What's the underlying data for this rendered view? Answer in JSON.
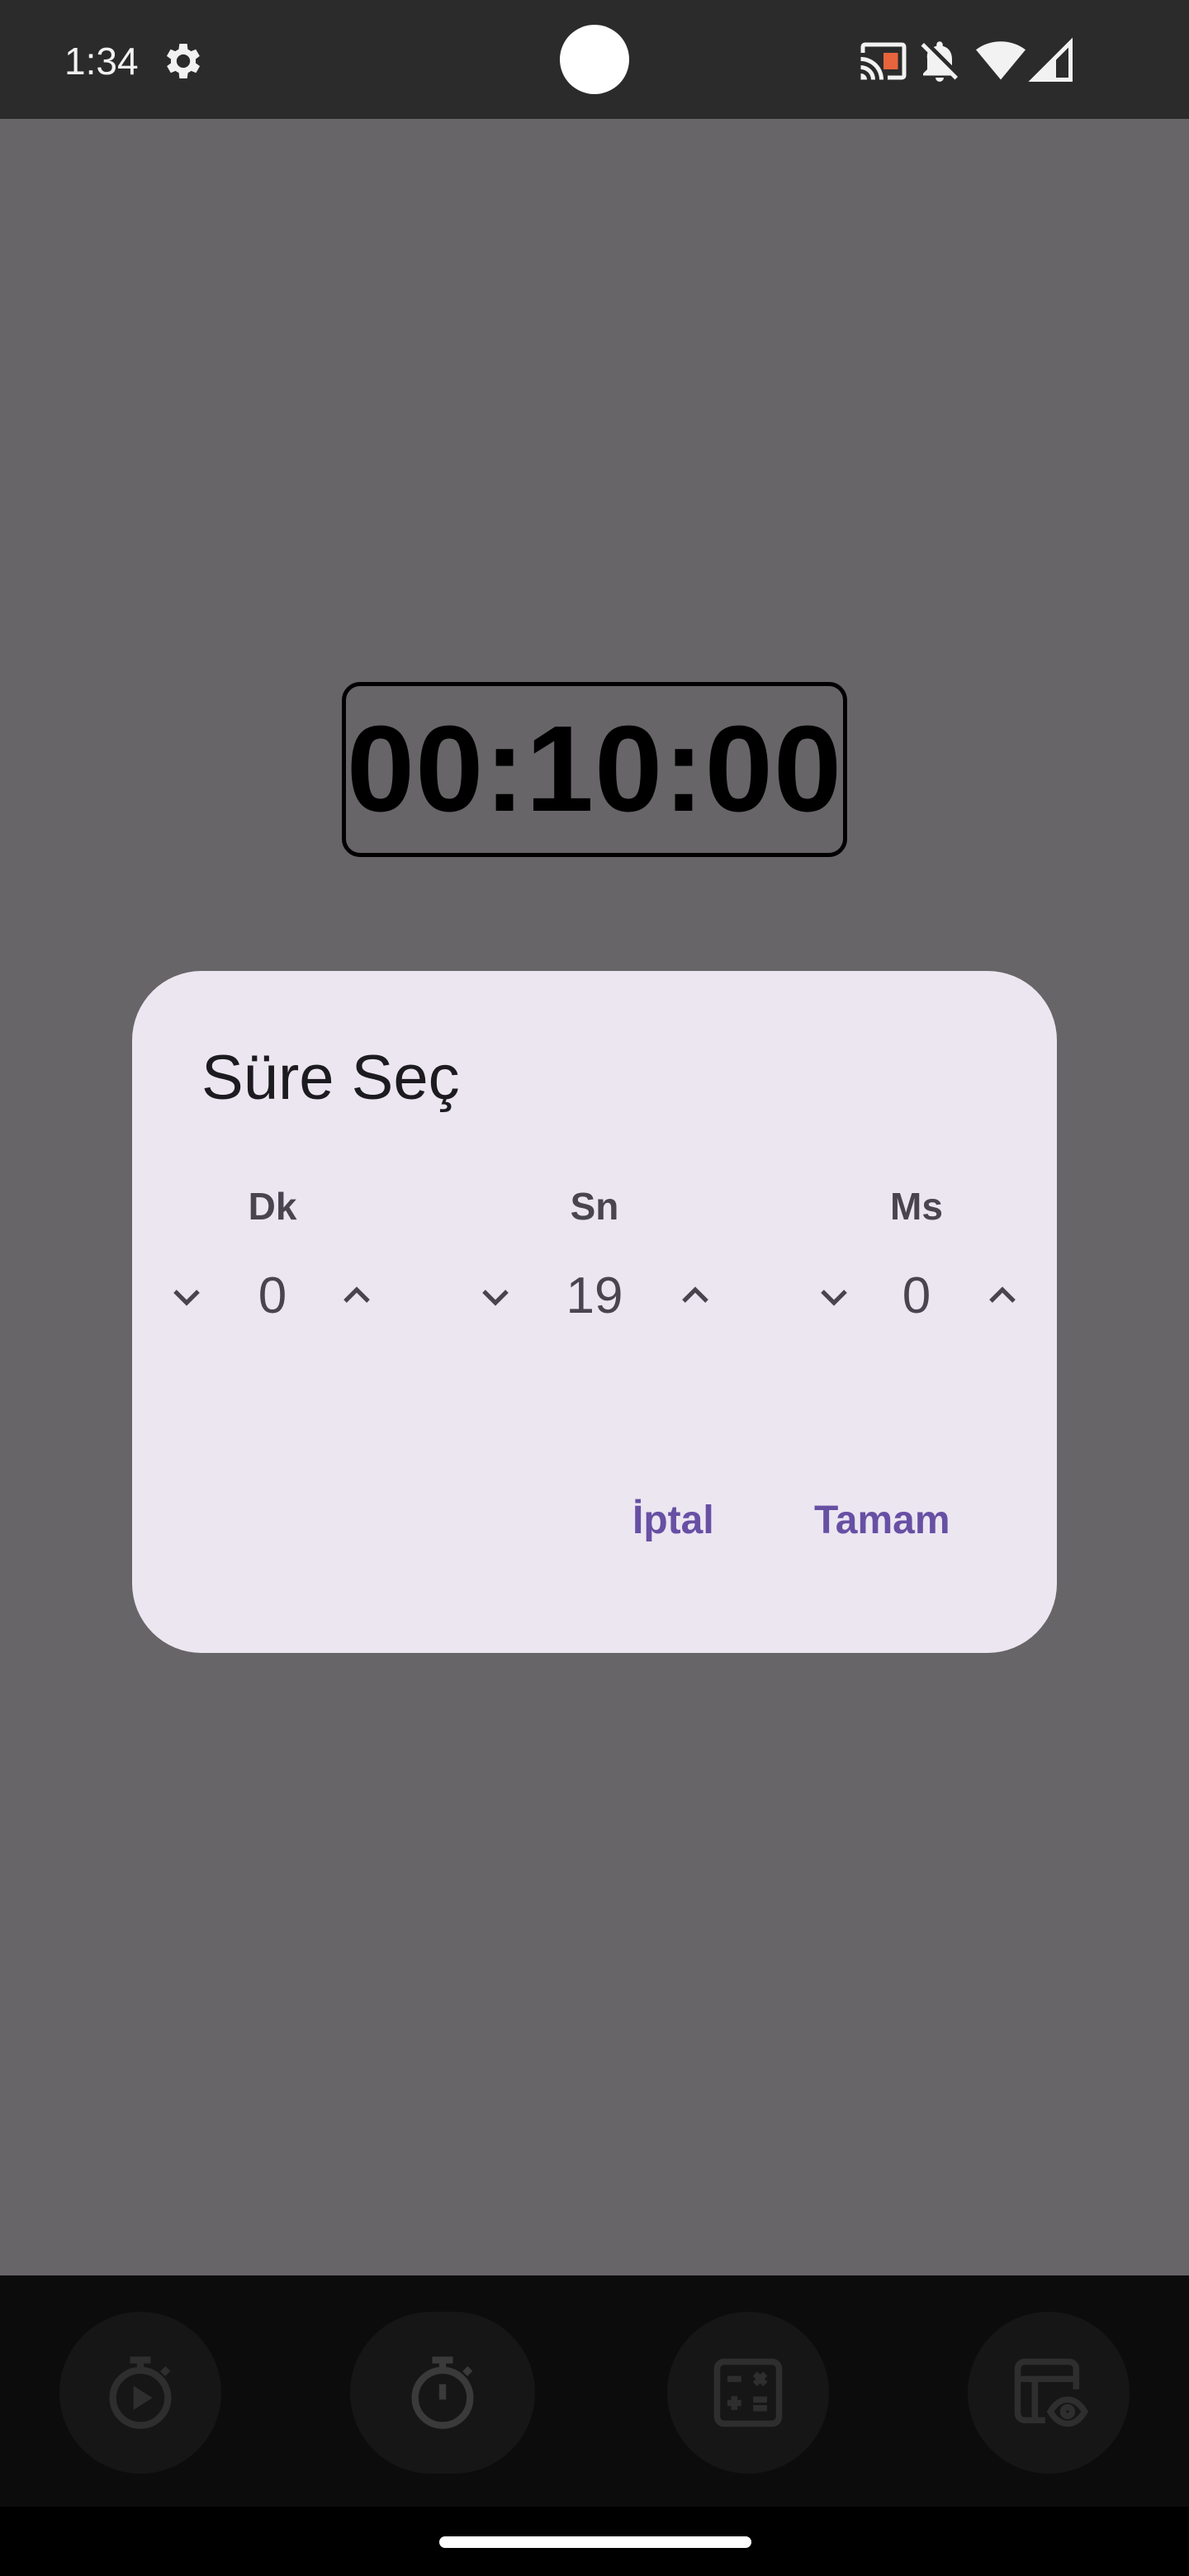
{
  "status_bar": {
    "time": "1:34",
    "icons": [
      "gear-icon",
      "cast-icon",
      "notifications-off-icon",
      "wifi-icon",
      "signal-icon"
    ]
  },
  "timer": {
    "display": "00:10:00"
  },
  "dialog": {
    "title": "Süre Seç",
    "columns": [
      {
        "label": "Dk",
        "value": "0"
      },
      {
        "label": "Sn",
        "value": "19"
      },
      {
        "label": "Ms",
        "value": "0"
      }
    ],
    "cancel_label": "İptal",
    "ok_label": "Tamam"
  },
  "bottom_nav": {
    "items": [
      "play-timer-icon",
      "stopwatch-icon",
      "calculator-icon",
      "table-view-icon"
    ],
    "selected_index": 1
  },
  "colors": {
    "scrim_background": "#676567",
    "dialog_background": "#ece6f1",
    "accent": "#6750a4",
    "status_bar": "#2b2b2b",
    "nav_bar": "#0c0c0c"
  }
}
